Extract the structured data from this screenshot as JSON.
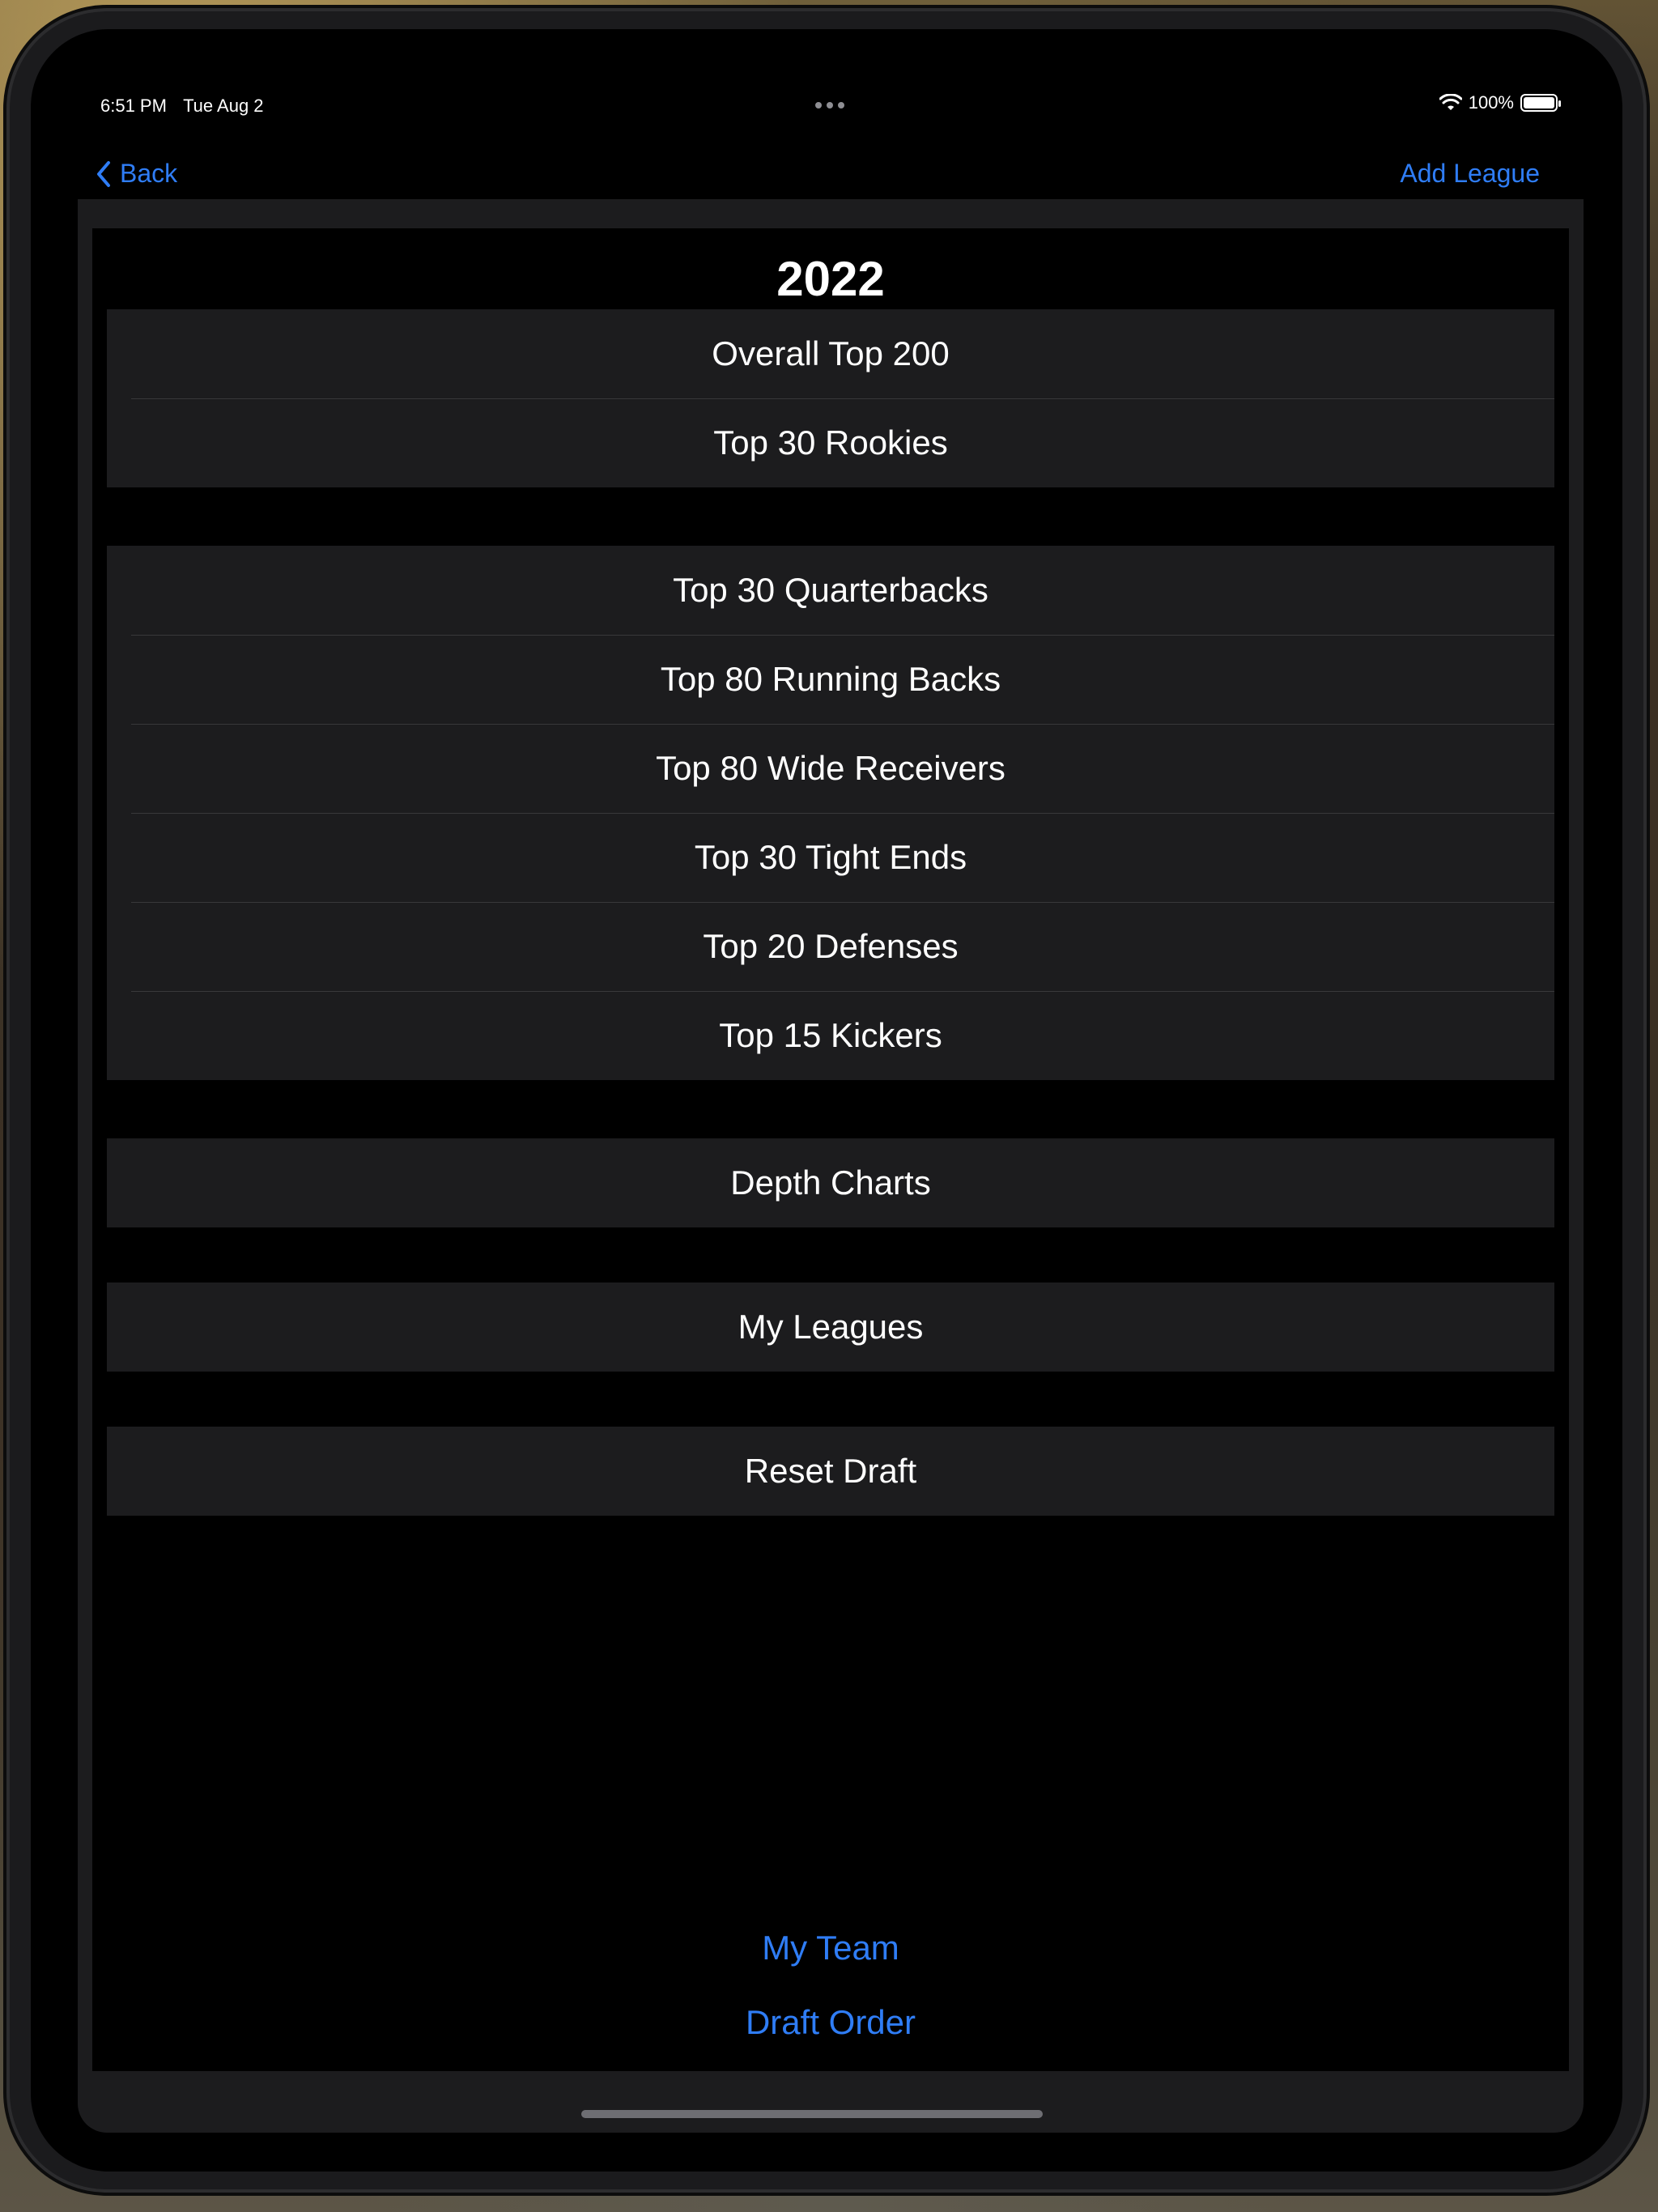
{
  "status_bar": {
    "time": "6:51 PM",
    "date": "Tue Aug 2",
    "battery_percent": "100%",
    "battery_level": 1.0,
    "wifi_icon": "wifi-icon"
  },
  "nav": {
    "back_label": "Back",
    "add_label": "Add League",
    "accent_color": "#2f7df6"
  },
  "title": "2022",
  "groups": [
    {
      "items": [
        "Overall Top 200",
        "Top 30 Rookies"
      ]
    },
    {
      "items": [
        "Top 30 Quarterbacks",
        "Top 80 Running Backs",
        "Top 80 Wide Receivers",
        "Top 30 Tight Ends",
        "Top 20 Defenses",
        "Top 15 Kickers"
      ]
    },
    {
      "items": [
        "Depth Charts"
      ]
    },
    {
      "items": [
        "My Leagues"
      ]
    },
    {
      "items": [
        "Reset Draft"
      ]
    }
  ],
  "bottom": {
    "my_team": "My Team",
    "draft_order": "Draft Order"
  }
}
